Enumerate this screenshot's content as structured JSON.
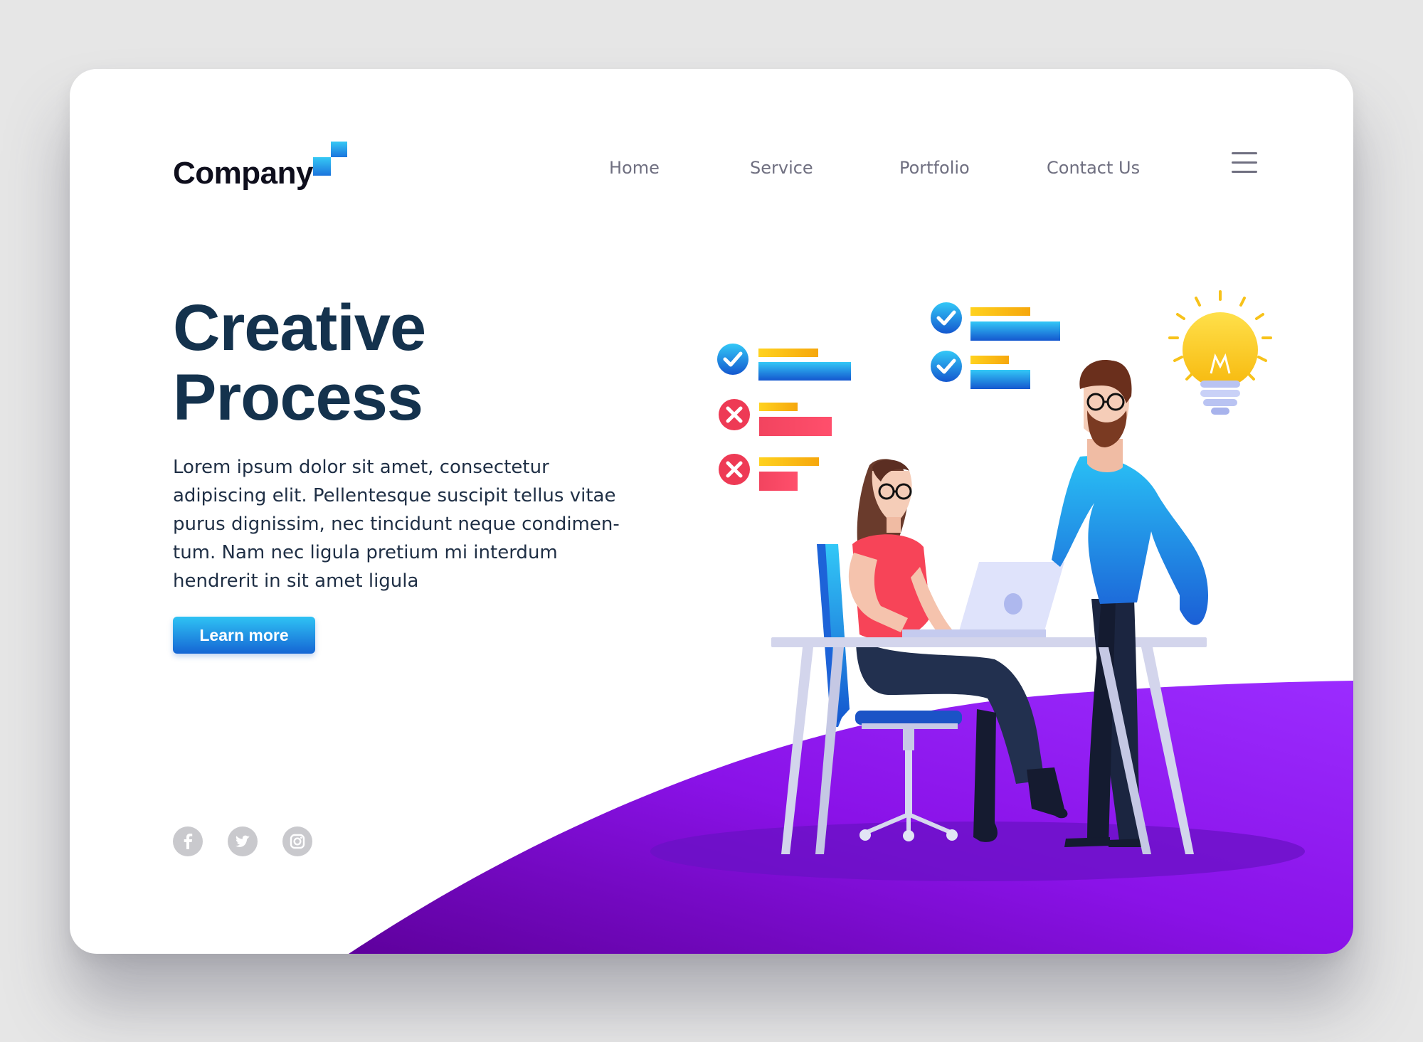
{
  "brand": {
    "name": "Company",
    "primary_color": "#14324d",
    "accent_gradient": [
      "#2fc3f4",
      "#1565d4"
    ]
  },
  "nav": {
    "items": [
      {
        "label": "Home"
      },
      {
        "label": "Service"
      },
      {
        "label": "Portfolio"
      },
      {
        "label": "Contact Us"
      }
    ],
    "menu_icon": "hamburger-menu-icon"
  },
  "hero": {
    "title_lines": [
      "Creative",
      "Process"
    ],
    "body_lines": [
      "Lorem ipsum dolor sit amet, consectetur",
      "adipiscing elit. Pellentesque suscipit tellus vitae",
      "purus dignissim, nec tincidunt neque condimen-",
      "tum. Nam nec ligula pretium mi interdum",
      "hendrerit in sit amet ligula"
    ],
    "cta_label": "Learn more"
  },
  "socials": [
    {
      "icon": "facebook-icon"
    },
    {
      "icon": "twitter-icon"
    },
    {
      "icon": "instagram-icon"
    }
  ],
  "illustration": {
    "purple_gradient": [
      "#5e009c",
      "#9b2cff"
    ],
    "checklist_icons": [
      "check-icon",
      "cross-icon",
      "cross-icon",
      "check-icon",
      "check-icon"
    ],
    "lightbulb_color": "#ffcc11"
  }
}
